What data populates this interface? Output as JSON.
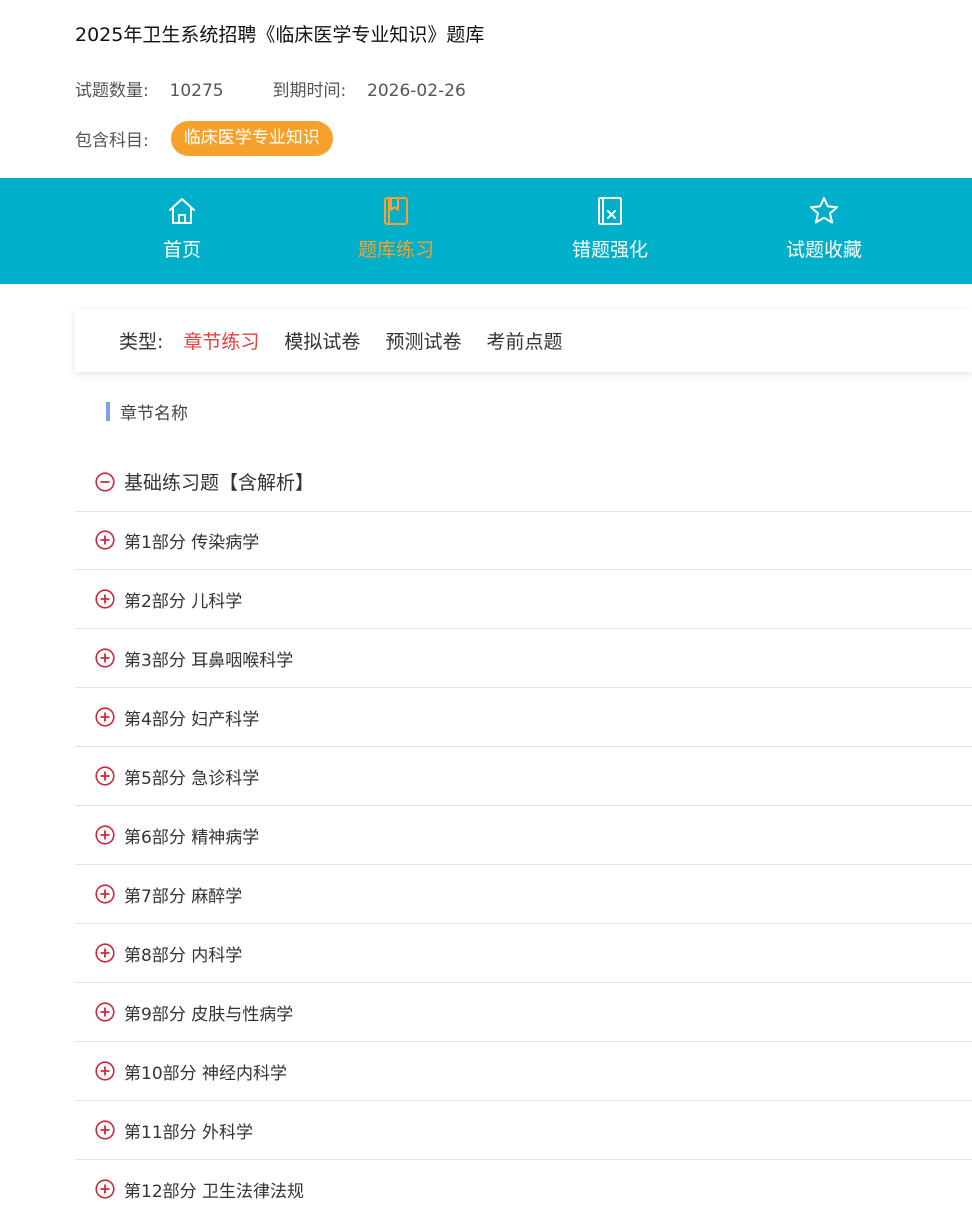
{
  "bank": {
    "title": "2025年卫生系统招聘《临床医学专业知识》题库",
    "question_count_label": "试题数量:",
    "question_count": "10275",
    "expiry_label": "到期时间:",
    "expiry_date": "2026-02-26",
    "subjects_label": "包含科目:",
    "subject": "临床医学专业知识"
  },
  "nav": {
    "home": "首页",
    "practice": "题库练习",
    "wrong": "错题强化",
    "favorites": "试题收藏"
  },
  "types": {
    "label": "类型:",
    "tabs": [
      "章节练习",
      "模拟试卷",
      "预测试卷",
      "考前点题"
    ],
    "active": "章节练习"
  },
  "section": {
    "heading": "章节名称"
  },
  "tree": {
    "root": "基础练习题【含解析】",
    "chapters": [
      "第1部分 传染病学",
      "第2部分 儿科学",
      "第3部分 耳鼻咽喉科学",
      "第4部分 妇产科学",
      "第5部分 急诊科学",
      "第6部分 精神病学",
      "第7部分 麻醉学",
      "第8部分 内科学",
      "第9部分 皮肤与性病学",
      "第10部分 神经内科学",
      "第11部分 外科学",
      "第12部分 卫生法律法规"
    ]
  },
  "colors": {
    "nav_bg": "#00afc9",
    "accent_orange": "#f5a12b",
    "active_tab_red": "#e0413c",
    "icon_red": "#d0283a"
  }
}
